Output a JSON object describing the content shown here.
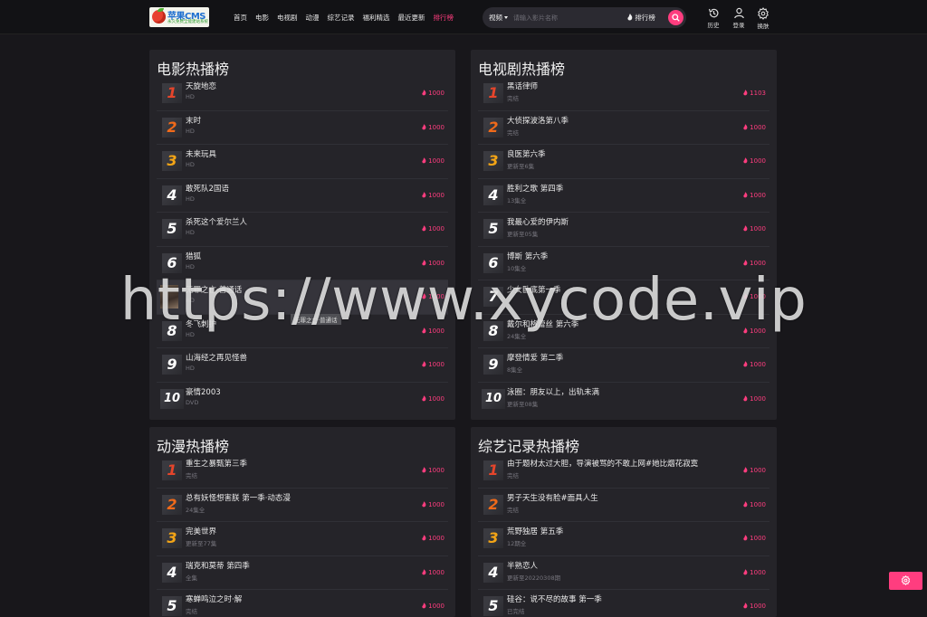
{
  "header": {
    "logo": {
      "brand": "苹果CMS",
      "slogan": "永久免费全能建站系统"
    },
    "nav": [
      {
        "label": "首页",
        "active": false
      },
      {
        "label": "电影",
        "active": false
      },
      {
        "label": "电视剧",
        "active": false
      },
      {
        "label": "动漫",
        "active": false
      },
      {
        "label": "综艺记录",
        "active": false
      },
      {
        "label": "福利精选",
        "active": false
      },
      {
        "label": "最近更新",
        "active": false
      },
      {
        "label": "排行榜",
        "active": true
      }
    ],
    "search": {
      "category": "视频",
      "placeholder": "请输入影片名称",
      "hot_label": "排行榜"
    },
    "icons": {
      "history": "历史",
      "login": "登录",
      "skin": "换肤"
    }
  },
  "panels": [
    {
      "title": "电影热播榜",
      "items": [
        {
          "rank": "1",
          "title": "天旋地恋",
          "sub": "HD",
          "score": "1000"
        },
        {
          "rank": "2",
          "title": "末时",
          "sub": "HD",
          "score": "1000"
        },
        {
          "rank": "3",
          "title": "未来玩具",
          "sub": "HD",
          "score": "1000"
        },
        {
          "rank": "4",
          "title": "敢死队2国语",
          "sub": "HD",
          "score": "1000"
        },
        {
          "rank": "5",
          "title": "杀死这个爱尔兰人",
          "sub": "HD",
          "score": "1000"
        },
        {
          "rank": "6",
          "title": "猎狐",
          "sub": "HD",
          "score": "1000"
        },
        {
          "rank": "7",
          "title": "无罪之亡·普通话",
          "sub": "HD",
          "score": "1000",
          "tag": "无罪之亡·普通话"
        },
        {
          "rank": "8",
          "title": "冬飞刺护",
          "sub": "HD",
          "score": "1000"
        },
        {
          "rank": "9",
          "title": "山海经之再见怪兽",
          "sub": "HD",
          "score": "1000"
        },
        {
          "rank": "10",
          "title": "豪情2003",
          "sub": "DVD",
          "score": "1000"
        }
      ]
    },
    {
      "title": "电视剧热播榜",
      "items": [
        {
          "rank": "1",
          "title": "黑话律师",
          "sub": "完结",
          "score": "1103"
        },
        {
          "rank": "2",
          "title": "大侦探波洛第八季",
          "sub": "完结",
          "score": "1000"
        },
        {
          "rank": "3",
          "title": "良医第六季",
          "sub": "更新至6集",
          "score": "1000"
        },
        {
          "rank": "4",
          "title": "胜利之歌 第四季",
          "sub": "13集全",
          "score": "1000"
        },
        {
          "rank": "5",
          "title": "我最心爱的伊内斯",
          "sub": "更新至05集",
          "score": "1000"
        },
        {
          "rank": "6",
          "title": "博斯 第六季",
          "sub": "10集全",
          "score": "1000"
        },
        {
          "rank": "7",
          "title": "少女卧底第一季",
          "sub": "",
          "score": "1000"
        },
        {
          "rank": "8",
          "title": "戴尔和格蕾丝 第六季",
          "sub": "24集全",
          "score": "1000"
        },
        {
          "rank": "9",
          "title": "摩登情爱 第二季",
          "sub": "8集全",
          "score": "1000"
        },
        {
          "rank": "10",
          "title": "泳圈：朋友以上，出轨未满",
          "sub": "更新至08集",
          "score": "1000"
        }
      ]
    },
    {
      "title": "动漫热播榜",
      "items": [
        {
          "rank": "1",
          "title": "重生之暴甄第三季",
          "sub": "完结",
          "score": "1000"
        },
        {
          "rank": "2",
          "title": "总有妖怪想害朕 第一季·动态漫",
          "sub": "24集全",
          "score": "1000"
        },
        {
          "rank": "3",
          "title": "完美世界",
          "sub": "更新至77集",
          "score": "1000"
        },
        {
          "rank": "4",
          "title": "瑞克和莫蒂 第四季",
          "sub": "全集",
          "score": "1000"
        },
        {
          "rank": "5",
          "title": "寒蝉鸣泣之时·解",
          "sub": "完结",
          "score": "1000"
        }
      ]
    },
    {
      "title": "综艺记录热播榜",
      "items": [
        {
          "rank": "1",
          "title": "由于题材太过大胆，导演被骂的不敢上网#她比烟花寂寞",
          "sub": "完结",
          "score": "1000"
        },
        {
          "rank": "2",
          "title": "男子天生没有脸#面具人生",
          "sub": "完结",
          "score": "1000"
        },
        {
          "rank": "3",
          "title": "荒野独居 第五季",
          "sub": "12期全",
          "score": "1000"
        },
        {
          "rank": "4",
          "title": "半熟恋人",
          "sub": "更新至20220308期",
          "score": "1000"
        },
        {
          "rank": "5",
          "title": "硅谷：说不尽的故事 第一季",
          "sub": "已完结",
          "score": "1000"
        }
      ]
    }
  ],
  "watermark": "https://www.xycode.vip",
  "colors": {
    "accent": "#ff3d7f",
    "panel": "#252429",
    "background": "#18171b"
  }
}
